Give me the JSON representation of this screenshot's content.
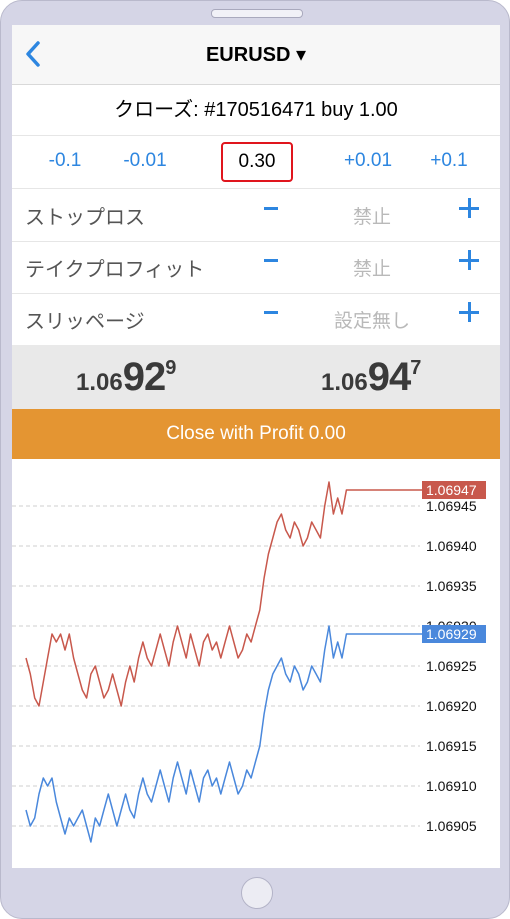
{
  "header": {
    "title": "EURUSD ▾"
  },
  "order": {
    "text": "クローズ: #170516471 buy 1.00"
  },
  "volume": {
    "minus_large": "-0.1",
    "minus_small": "-0.01",
    "value": "0.30",
    "plus_small": "+0.01",
    "plus_large": "+0.1"
  },
  "params": [
    {
      "label": "ストップロス",
      "value": "禁止"
    },
    {
      "label": "テイクプロフィット",
      "value": "禁止"
    },
    {
      "label": "スリッページ",
      "value": "設定無し"
    }
  ],
  "prices": {
    "bid": {
      "prefix": "1.06",
      "big": "92",
      "sup": "9"
    },
    "ask": {
      "prefix": "1.06",
      "big": "94",
      "sup": "7"
    }
  },
  "close_button": {
    "label": "Close with Profit 0.00"
  },
  "colors": {
    "accent": "#2d86e0",
    "ask_line": "#c8584c",
    "bid_line": "#4a88dc",
    "close_button": "#e49532",
    "highlight_border": "#e0151d"
  },
  "chart_data": {
    "type": "line",
    "ylim": [
      1.06902,
      1.0695
    ],
    "y_ticks": [
      "1.06905",
      "1.06910",
      "1.06915",
      "1.06920",
      "1.06925",
      "1.06930",
      "1.06935",
      "1.06940",
      "1.06945"
    ],
    "grid": true,
    "series": [
      {
        "current_label": "1.06947",
        "values": [
          1.06926,
          1.06924,
          1.06921,
          1.0692,
          1.06923,
          1.06926,
          1.06929,
          1.06928,
          1.06929,
          1.06927,
          1.06929,
          1.06926,
          1.06924,
          1.06922,
          1.06921,
          1.06924,
          1.06925,
          1.06923,
          1.06921,
          1.06922,
          1.06924,
          1.06922,
          1.0692,
          1.06923,
          1.06925,
          1.06923,
          1.06926,
          1.06928,
          1.06926,
          1.06925,
          1.06927,
          1.06929,
          1.06927,
          1.06925,
          1.06928,
          1.0693,
          1.06928,
          1.06926,
          1.06929,
          1.06927,
          1.06925,
          1.06928,
          1.06929,
          1.06927,
          1.06928,
          1.06926,
          1.06928,
          1.0693,
          1.06928,
          1.06926,
          1.06927,
          1.06929,
          1.06928,
          1.0693,
          1.06932,
          1.06936,
          1.06939,
          1.06941,
          1.06943,
          1.06944,
          1.06942,
          1.06941,
          1.06943,
          1.06942,
          1.0694,
          1.06941,
          1.06943,
          1.06942,
          1.06941,
          1.06945,
          1.06948,
          1.06944,
          1.06946,
          1.06944,
          1.06947,
          1.06947,
          1.06947,
          1.06947,
          1.06947,
          1.06947
        ]
      },
      {
        "current_label": "1.06929",
        "values": [
          1.06907,
          1.06905,
          1.06906,
          1.06909,
          1.06911,
          1.0691,
          1.06911,
          1.06908,
          1.06906,
          1.06904,
          1.06906,
          1.06905,
          1.06906,
          1.06907,
          1.06905,
          1.06903,
          1.06906,
          1.06905,
          1.06907,
          1.06909,
          1.06907,
          1.06905,
          1.06907,
          1.06909,
          1.06907,
          1.06906,
          1.06909,
          1.06911,
          1.06909,
          1.06908,
          1.0691,
          1.06912,
          1.0691,
          1.06908,
          1.06911,
          1.06913,
          1.06911,
          1.06909,
          1.06912,
          1.0691,
          1.06908,
          1.06911,
          1.06912,
          1.0691,
          1.06911,
          1.06909,
          1.06911,
          1.06913,
          1.06911,
          1.06909,
          1.0691,
          1.06912,
          1.06911,
          1.06913,
          1.06915,
          1.06919,
          1.06922,
          1.06924,
          1.06925,
          1.06926,
          1.06924,
          1.06923,
          1.06925,
          1.06924,
          1.06922,
          1.06923,
          1.06925,
          1.06924,
          1.06923,
          1.06927,
          1.0693,
          1.06926,
          1.06928,
          1.06926,
          1.06929,
          1.06929,
          1.06929,
          1.06929,
          1.06929,
          1.06929
        ]
      }
    ]
  }
}
